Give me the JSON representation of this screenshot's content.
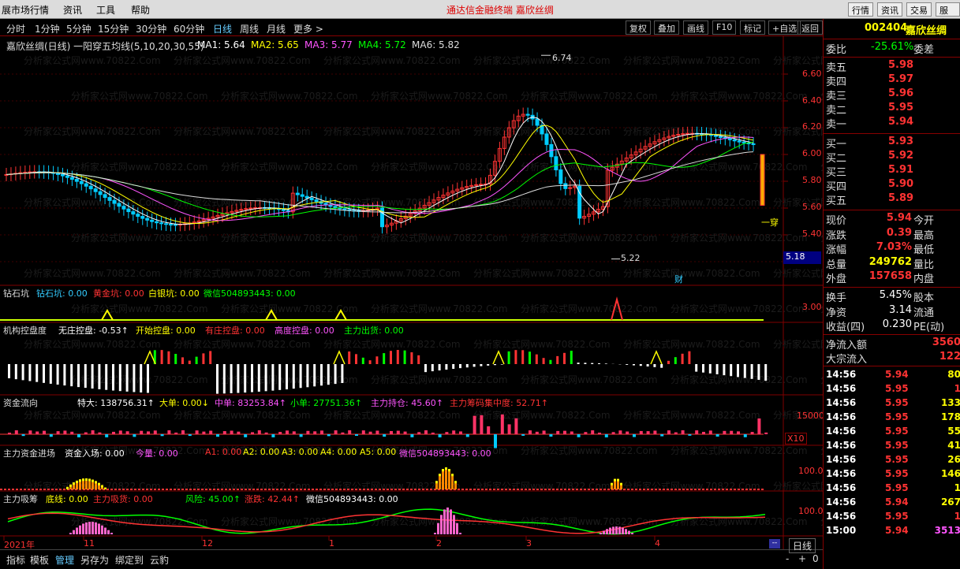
{
  "menubar": {
    "items": [
      "展市场行情",
      "资讯",
      "工具",
      "帮助"
    ],
    "center_title": "通达信金融终端   嘉欣丝绸",
    "right_buttons": [
      "行情",
      "资讯",
      "交易",
      "服务"
    ]
  },
  "periods": [
    "分时",
    "1分钟",
    "5分钟",
    "15分钟",
    "30分钟",
    "60分钟",
    "日线",
    "周线",
    "月线",
    "更多 >"
  ],
  "active_period": "日线",
  "tools": [
    "复权",
    "叠加",
    "画线",
    "F10",
    "标记",
    "+自选",
    "返回"
  ],
  "main_chart": {
    "title": "嘉欣丝绸(日线) 一阳穿五均线(5,10,20,30,55)",
    "ma": [
      {
        "label": "MA1: 5.64",
        "color": "#ffffff"
      },
      {
        "label": "MA2: 5.65",
        "color": "#ffff00"
      },
      {
        "label": "MA3: 5.77",
        "color": "#ff55ff"
      },
      {
        "label": "MA4: 5.72",
        "color": "#00ff00"
      },
      {
        "label": "MA6: 5.82",
        "color": "#dddddd"
      }
    ],
    "y_ticks": [
      "6.60",
      "6.40",
      "6.20",
      "6.00",
      "5.80",
      "5.60",
      "5.40"
    ],
    "high_label": "6.74",
    "low_label": "5.22",
    "current_box": "5.18",
    "marker_text": "财",
    "side_note": "一穿"
  },
  "watermark": "分析家公式网www.70822.Com",
  "panel_zs": {
    "title": "钻石坑",
    "items": [
      {
        "text": "钻石坑: 0.00",
        "color": "#33ccff"
      },
      {
        "text": "黄金坑: 0.00",
        "color": "#ff3333"
      },
      {
        "text": "白银坑: 0.00",
        "color": "#ffff00"
      },
      {
        "text": "微信504893443: 0.00",
        "color": "#00ff00"
      }
    ],
    "y_tick": "3.00"
  },
  "panel_jg": {
    "title": "机构控盘度",
    "items": [
      {
        "text": "无庄控盘: -0.53↑",
        "color": "#ffffff"
      },
      {
        "text": "开始控盘: 0.00",
        "color": "#ffff00"
      },
      {
        "text": "有庄控盘: 0.00",
        "color": "#ff3333"
      },
      {
        "text": "高度控盘: 0.00",
        "color": "#ff55ff"
      },
      {
        "text": "主力出货: 0.00",
        "color": "#00ff00"
      }
    ]
  },
  "panel_zj": {
    "title": "资金流向",
    "items": [
      {
        "text": "特大: 138756.31↑",
        "color": "#ffffff"
      },
      {
        "text": "大单: 0.00↓",
        "color": "#ffff00"
      },
      {
        "text": "中单: 83253.84↑",
        "color": "#ff55ff"
      },
      {
        "text": "小单: 27751.36↑",
        "color": "#00ff00"
      },
      {
        "text": "主力持仓: 45.60↑",
        "color": "#ff55ff"
      },
      {
        "text": "主力筹码集中度: 52.71↑",
        "color": "#ff3333"
      }
    ],
    "y_tick": "15000",
    "x_mark": "X10"
  },
  "panel_jc": {
    "title": "主力资金进场",
    "items": [
      {
        "text": "资金入场: 0.00",
        "color": "#ffffff"
      },
      {
        "text": "今量: 0.00",
        "color": "#ff55ff"
      },
      {
        "text": "A1: 0.00",
        "color": "#ff3333"
      },
      {
        "text": "A2: 0.00",
        "color": "#ffff00"
      },
      {
        "text": "A3: 0.00",
        "color": "#ffff00"
      },
      {
        "text": "A4: 0.00",
        "color": "#ffff00"
      },
      {
        "text": "A5: 0.00",
        "color": "#ffff00"
      },
      {
        "text": "微信504893443: 0.00",
        "color": "#ff55ff"
      }
    ],
    "y_tick": "100.0"
  },
  "panel_xc": {
    "title": "主力吸筹",
    "items": [
      {
        "text": "底线: 0.00",
        "color": "#ffff00"
      },
      {
        "text": "主力吸货: 0.00",
        "color": "#ff3333"
      },
      {
        "text": "风险: 45.00↑",
        "color": "#00ff00"
      },
      {
        "text": "涨跌: 42.44↑",
        "color": "#ff3333"
      },
      {
        "text": "微信504893443: 0.00",
        "color": "#ffffff"
      }
    ],
    "y_tick": "100.0"
  },
  "x_axis": [
    {
      "label": "2021年",
      "pos": 0.005
    },
    {
      "label": "11",
      "pos": 0.107
    },
    {
      "label": "12",
      "pos": 0.258
    },
    {
      "label": "1",
      "pos": 0.42
    },
    {
      "label": "2",
      "pos": 0.557
    },
    {
      "label": "3",
      "pos": 0.672
    },
    {
      "label": "4",
      "pos": 0.836
    }
  ],
  "bottom_tabs": [
    "指标",
    "模板",
    "管理",
    "另存为",
    "绑定到",
    "云豹"
  ],
  "active_bottom": "管理",
  "period_box": "日线",
  "quote": {
    "code": "002404",
    "name": "嘉欣丝绸",
    "wb_label": "委比",
    "wb_value": "-25.61%",
    "wc_label": "委差",
    "asks": [
      {
        "label": "卖五",
        "price": "5.98"
      },
      {
        "label": "卖四",
        "price": "5.97"
      },
      {
        "label": "卖三",
        "price": "5.96"
      },
      {
        "label": "卖二",
        "price": "5.95"
      },
      {
        "label": "卖一",
        "price": "5.94"
      }
    ],
    "bids": [
      {
        "label": "买一",
        "price": "5.93"
      },
      {
        "label": "买二",
        "price": "5.92"
      },
      {
        "label": "买三",
        "price": "5.91"
      },
      {
        "label": "买四",
        "price": "5.90"
      },
      {
        "label": "买五",
        "price": "5.89"
      }
    ],
    "stats": [
      {
        "l1": "现价",
        "v": "5.94",
        "vc": "#ff3333",
        "l2": "今开"
      },
      {
        "l1": "涨跌",
        "v": "0.39",
        "vc": "#ff3333",
        "l2": "最高"
      },
      {
        "l1": "涨幅",
        "v": "7.03%",
        "vc": "#ff3333",
        "l2": "最低"
      },
      {
        "l1": "总量",
        "v": "249762",
        "vc": "#ffff00",
        "l2": "量比"
      },
      {
        "l1": "外盘",
        "v": "157658",
        "vc": "#ff3333",
        "l2": "内盘"
      }
    ],
    "stats2": [
      {
        "l1": "换手",
        "v": "5.45%",
        "vc": "#ffffff",
        "l2": "股本"
      },
      {
        "l1": "净资",
        "v": "3.14",
        "vc": "#ffffff",
        "l2": "流通"
      },
      {
        "l1": "收益(四)",
        "v": "0.230",
        "vc": "#ffffff",
        "l2": "PE(动)"
      }
    ],
    "flows": [
      {
        "label": "净流入额",
        "value": "3560"
      },
      {
        "label": "大宗流入",
        "value": "122"
      }
    ],
    "ticks": [
      {
        "t": "14:56",
        "p": "5.94",
        "pc": "#ff3333",
        "v": "80",
        "vc": "#ffff00"
      },
      {
        "t": "14:56",
        "p": "5.95",
        "pc": "#ff3333",
        "v": "1",
        "vc": "#ff3333"
      },
      {
        "t": "14:56",
        "p": "5.95",
        "pc": "#ff3333",
        "v": "133",
        "vc": "#ffff00"
      },
      {
        "t": "14:56",
        "p": "5.95",
        "pc": "#ff3333",
        "v": "178",
        "vc": "#ffff00"
      },
      {
        "t": "14:56",
        "p": "5.95",
        "pc": "#ff3333",
        "v": "55",
        "vc": "#ffff00"
      },
      {
        "t": "14:56",
        "p": "5.95",
        "pc": "#ff3333",
        "v": "41",
        "vc": "#ffff00"
      },
      {
        "t": "14:56",
        "p": "5.95",
        "pc": "#ff3333",
        "v": "26",
        "vc": "#ffff00"
      },
      {
        "t": "14:56",
        "p": "5.95",
        "pc": "#ff3333",
        "v": "146",
        "vc": "#ffff00"
      },
      {
        "t": "14:56",
        "p": "5.95",
        "pc": "#ff3333",
        "v": "1",
        "vc": "#ffff00"
      },
      {
        "t": "14:56",
        "p": "5.94",
        "pc": "#ff3333",
        "v": "267",
        "vc": "#ffff00"
      },
      {
        "t": "14:56",
        "p": "5.95",
        "pc": "#ff3333",
        "v": "1",
        "vc": "#ff3333"
      },
      {
        "t": "15:00",
        "p": "5.94",
        "pc": "#ff3333",
        "v": "3513",
        "vc": "#ff55ff"
      }
    ]
  }
}
